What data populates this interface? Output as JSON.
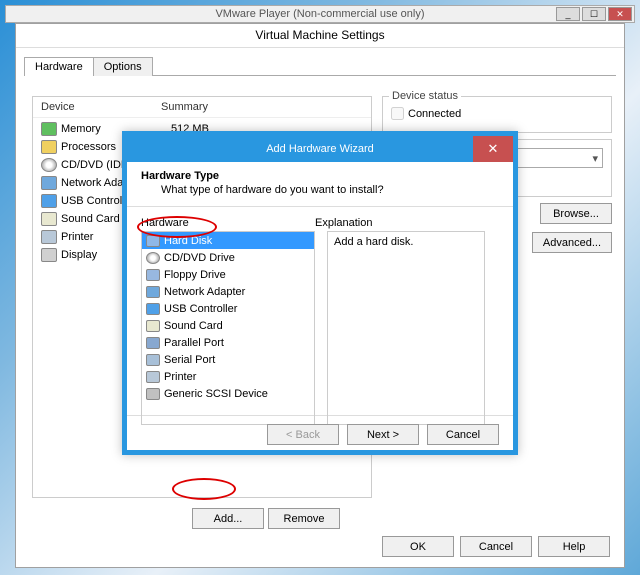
{
  "parent_window": {
    "title": "VMware Player (Non-commercial use only)"
  },
  "settings": {
    "title": "Virtual Machine Settings",
    "tabs": {
      "hardware": "Hardware",
      "options": "Options"
    },
    "device_header": "Device",
    "summary_header": "Summary",
    "devices": [
      {
        "name": "Memory",
        "summary": "512 MB",
        "ico": "mem"
      },
      {
        "name": "Processors",
        "summary": "",
        "ico": "cpu"
      },
      {
        "name": "CD/DVD (IDE)",
        "summary": "",
        "ico": "cd"
      },
      {
        "name": "Network Adap",
        "summary": "",
        "ico": "net"
      },
      {
        "name": "USB Controller",
        "summary": "",
        "ico": "usb"
      },
      {
        "name": "Sound Card",
        "summary": "",
        "ico": "snd"
      },
      {
        "name": "Printer",
        "summary": "",
        "ico": "prn"
      },
      {
        "name": "Display",
        "summary": "",
        "ico": "disp"
      }
    ],
    "status_group": "Device status",
    "connected_label": "Connected",
    "browse": "Browse...",
    "advanced": "Advanced...",
    "add": "Add...",
    "remove": "Remove",
    "ok": "OK",
    "cancel": "Cancel",
    "help": "Help"
  },
  "wizard": {
    "title": "Add Hardware Wizard",
    "head_title": "Hardware Type",
    "head_sub": "What type of hardware do you want to install?",
    "hw_label": "Hardware",
    "exp_label": "Explanation",
    "exp_text": "Add a hard disk.",
    "back": "< Back",
    "next": "Next >",
    "cancel": "Cancel",
    "items": [
      {
        "label": "Hard Disk",
        "ico": "hdd",
        "selected": true
      },
      {
        "label": "CD/DVD Drive",
        "ico": "cd"
      },
      {
        "label": "Floppy Drive",
        "ico": "flp"
      },
      {
        "label": "Network Adapter",
        "ico": "net"
      },
      {
        "label": "USB Controller",
        "ico": "usb"
      },
      {
        "label": "Sound Card",
        "ico": "snd"
      },
      {
        "label": "Parallel Port",
        "ico": "par"
      },
      {
        "label": "Serial Port",
        "ico": "ser"
      },
      {
        "label": "Printer",
        "ico": "prn"
      },
      {
        "label": "Generic SCSI Device",
        "ico": "scsi"
      }
    ]
  }
}
